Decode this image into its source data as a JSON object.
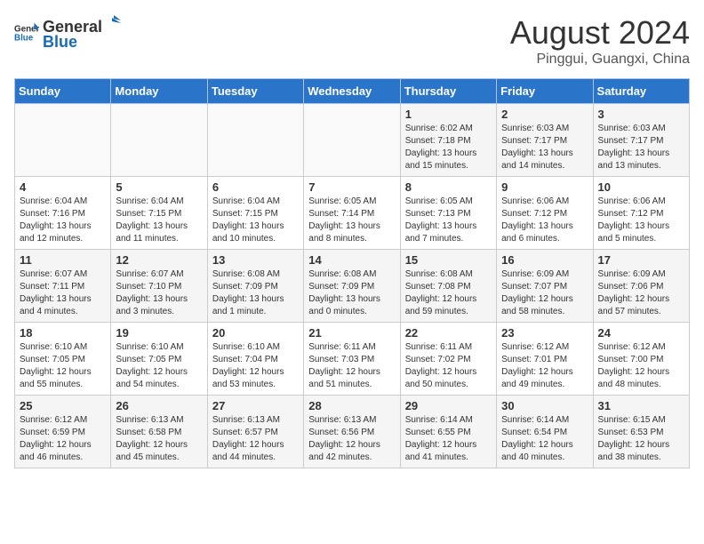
{
  "header": {
    "logo_general": "General",
    "logo_blue": "Blue",
    "title": "August 2024",
    "subtitle": "Pinggui, Guangxi, China"
  },
  "weekdays": [
    "Sunday",
    "Monday",
    "Tuesday",
    "Wednesday",
    "Thursday",
    "Friday",
    "Saturday"
  ],
  "weeks": [
    [
      {
        "day": "",
        "info": ""
      },
      {
        "day": "",
        "info": ""
      },
      {
        "day": "",
        "info": ""
      },
      {
        "day": "",
        "info": ""
      },
      {
        "day": "1",
        "info": "Sunrise: 6:02 AM\nSunset: 7:18 PM\nDaylight: 13 hours and 15 minutes."
      },
      {
        "day": "2",
        "info": "Sunrise: 6:03 AM\nSunset: 7:17 PM\nDaylight: 13 hours and 14 minutes."
      },
      {
        "day": "3",
        "info": "Sunrise: 6:03 AM\nSunset: 7:17 PM\nDaylight: 13 hours and 13 minutes."
      }
    ],
    [
      {
        "day": "4",
        "info": "Sunrise: 6:04 AM\nSunset: 7:16 PM\nDaylight: 13 hours and 12 minutes."
      },
      {
        "day": "5",
        "info": "Sunrise: 6:04 AM\nSunset: 7:15 PM\nDaylight: 13 hours and 11 minutes."
      },
      {
        "day": "6",
        "info": "Sunrise: 6:04 AM\nSunset: 7:15 PM\nDaylight: 13 hours and 10 minutes."
      },
      {
        "day": "7",
        "info": "Sunrise: 6:05 AM\nSunset: 7:14 PM\nDaylight: 13 hours and 8 minutes."
      },
      {
        "day": "8",
        "info": "Sunrise: 6:05 AM\nSunset: 7:13 PM\nDaylight: 13 hours and 7 minutes."
      },
      {
        "day": "9",
        "info": "Sunrise: 6:06 AM\nSunset: 7:12 PM\nDaylight: 13 hours and 6 minutes."
      },
      {
        "day": "10",
        "info": "Sunrise: 6:06 AM\nSunset: 7:12 PM\nDaylight: 13 hours and 5 minutes."
      }
    ],
    [
      {
        "day": "11",
        "info": "Sunrise: 6:07 AM\nSunset: 7:11 PM\nDaylight: 13 hours and 4 minutes."
      },
      {
        "day": "12",
        "info": "Sunrise: 6:07 AM\nSunset: 7:10 PM\nDaylight: 13 hours and 3 minutes."
      },
      {
        "day": "13",
        "info": "Sunrise: 6:08 AM\nSunset: 7:09 PM\nDaylight: 13 hours and 1 minute."
      },
      {
        "day": "14",
        "info": "Sunrise: 6:08 AM\nSunset: 7:09 PM\nDaylight: 13 hours and 0 minutes."
      },
      {
        "day": "15",
        "info": "Sunrise: 6:08 AM\nSunset: 7:08 PM\nDaylight: 12 hours and 59 minutes."
      },
      {
        "day": "16",
        "info": "Sunrise: 6:09 AM\nSunset: 7:07 PM\nDaylight: 12 hours and 58 minutes."
      },
      {
        "day": "17",
        "info": "Sunrise: 6:09 AM\nSunset: 7:06 PM\nDaylight: 12 hours and 57 minutes."
      }
    ],
    [
      {
        "day": "18",
        "info": "Sunrise: 6:10 AM\nSunset: 7:05 PM\nDaylight: 12 hours and 55 minutes."
      },
      {
        "day": "19",
        "info": "Sunrise: 6:10 AM\nSunset: 7:05 PM\nDaylight: 12 hours and 54 minutes."
      },
      {
        "day": "20",
        "info": "Sunrise: 6:10 AM\nSunset: 7:04 PM\nDaylight: 12 hours and 53 minutes."
      },
      {
        "day": "21",
        "info": "Sunrise: 6:11 AM\nSunset: 7:03 PM\nDaylight: 12 hours and 51 minutes."
      },
      {
        "day": "22",
        "info": "Sunrise: 6:11 AM\nSunset: 7:02 PM\nDaylight: 12 hours and 50 minutes."
      },
      {
        "day": "23",
        "info": "Sunrise: 6:12 AM\nSunset: 7:01 PM\nDaylight: 12 hours and 49 minutes."
      },
      {
        "day": "24",
        "info": "Sunrise: 6:12 AM\nSunset: 7:00 PM\nDaylight: 12 hours and 48 minutes."
      }
    ],
    [
      {
        "day": "25",
        "info": "Sunrise: 6:12 AM\nSunset: 6:59 PM\nDaylight: 12 hours and 46 minutes."
      },
      {
        "day": "26",
        "info": "Sunrise: 6:13 AM\nSunset: 6:58 PM\nDaylight: 12 hours and 45 minutes."
      },
      {
        "day": "27",
        "info": "Sunrise: 6:13 AM\nSunset: 6:57 PM\nDaylight: 12 hours and 44 minutes."
      },
      {
        "day": "28",
        "info": "Sunrise: 6:13 AM\nSunset: 6:56 PM\nDaylight: 12 hours and 42 minutes."
      },
      {
        "day": "29",
        "info": "Sunrise: 6:14 AM\nSunset: 6:55 PM\nDaylight: 12 hours and 41 minutes."
      },
      {
        "day": "30",
        "info": "Sunrise: 6:14 AM\nSunset: 6:54 PM\nDaylight: 12 hours and 40 minutes."
      },
      {
        "day": "31",
        "info": "Sunrise: 6:15 AM\nSunset: 6:53 PM\nDaylight: 12 hours and 38 minutes."
      }
    ]
  ]
}
